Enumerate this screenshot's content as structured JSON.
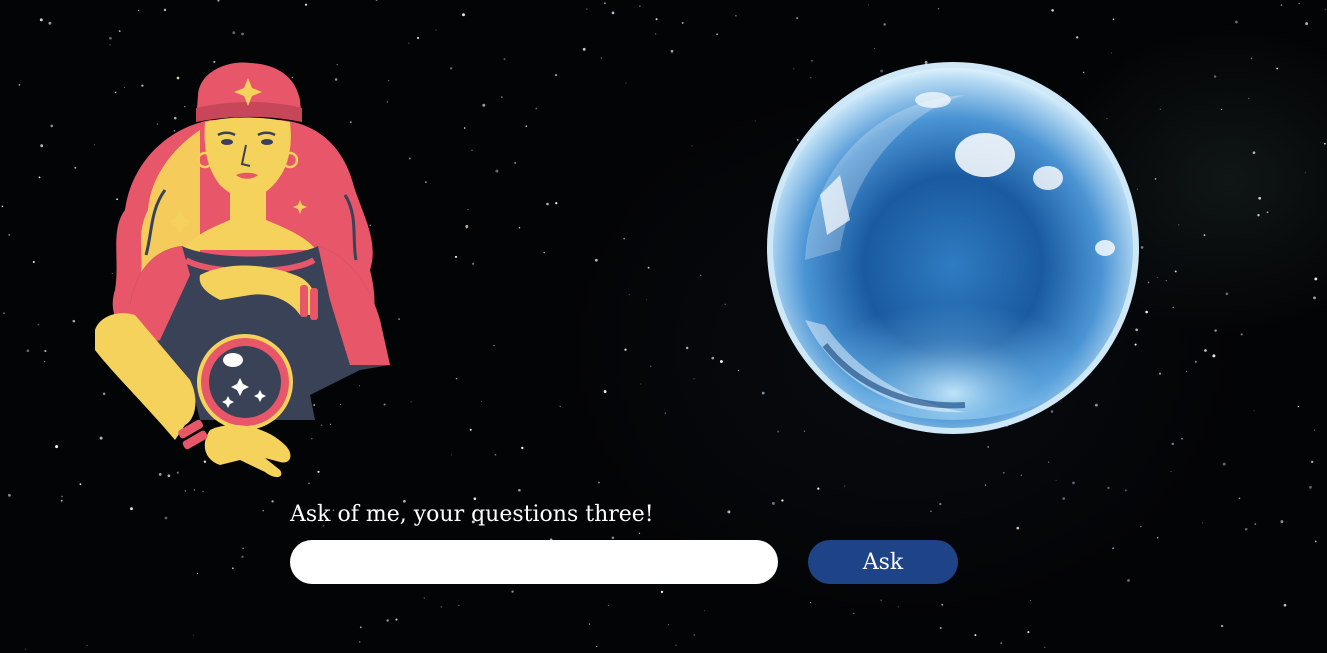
{
  "form": {
    "prompt_label": "Ask of me, your questions three!",
    "question_value": "",
    "question_placeholder": "",
    "ask_label": "Ask"
  },
  "images": {
    "fortune_teller": "fortune-teller-illustration",
    "crystal_ball": "crystal-ball-illustration",
    "background": "starry-night-sky"
  },
  "colors": {
    "background": "#030406",
    "ask_button": "#1e4387",
    "prompt_text": "#ffffff",
    "teller_skin": "#f5d25b",
    "teller_red": "#e8566a",
    "teller_dark": "#3a4257"
  }
}
